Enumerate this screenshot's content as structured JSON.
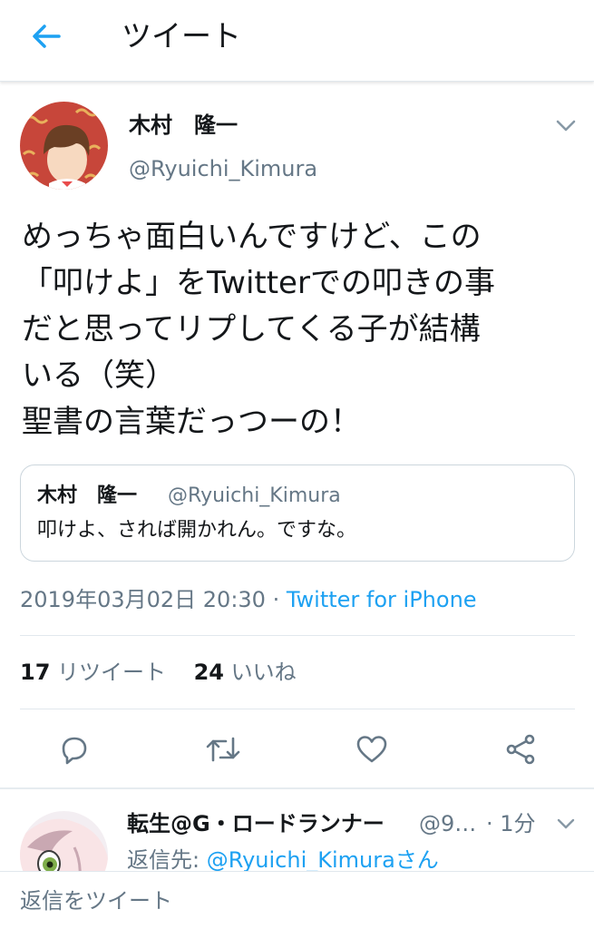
{
  "header": {
    "title": "ツイート",
    "back_icon": "arrow-left-icon",
    "accent": "#1da1f2"
  },
  "tweet": {
    "author_name": "木村　隆一",
    "author_handle": "@Ryuichi_Kimura",
    "text": "めっちゃ面白いんですけど、この\n「叩けよ」をTwitterでの叩きの事\nだと思ってリプしてくる子が結構\nいる（笑）\n聖書の言葉だっつーの！",
    "quote": {
      "author_name": "木村　隆一",
      "author_handle": "@Ryuichi_Kimura",
      "text": "叩けよ、されば開かれん。ですな。"
    },
    "timestamp": "2019年03月02日 20:30",
    "separator": " · ",
    "source": "Twitter for iPhone",
    "retweet_count": "17",
    "retweet_label": "リツイート",
    "like_count": "24",
    "like_label": "いいね",
    "actions": [
      "reply-icon",
      "retweet-icon",
      "like-icon",
      "share-icon"
    ]
  },
  "reply": {
    "author_name": "転生@G・ロードランナー",
    "author_handle": "@9…",
    "time": "· 1分",
    "reply_prefix": "返信先: ",
    "reply_to": "@Ryuichi_Kimuraさん"
  },
  "compose": {
    "placeholder": "返信をツイート"
  },
  "colors": {
    "text_primary": "#14171a",
    "text_secondary": "#657786",
    "link": "#1da1f2",
    "border": "#e1e8ed"
  }
}
